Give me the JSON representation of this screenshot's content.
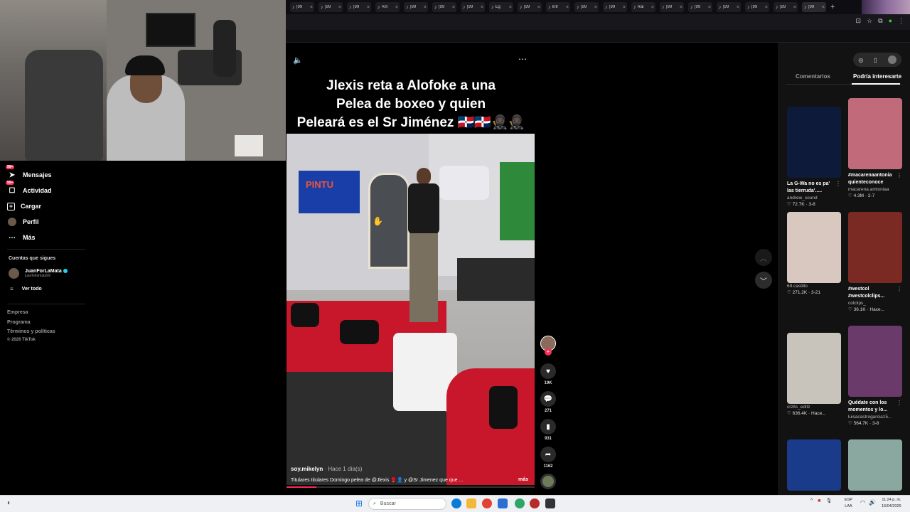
{
  "browser": {
    "tabs": [
      {
        "label": "(99"
      },
      {
        "label": "(99"
      },
      {
        "label": "(99"
      },
      {
        "label": "Am"
      },
      {
        "label": "(99"
      },
      {
        "label": "(99"
      },
      {
        "label": "(99"
      },
      {
        "label": "Eg"
      },
      {
        "label": "(99"
      },
      {
        "label": "Intr"
      },
      {
        "label": "(99"
      },
      {
        "label": "(99"
      },
      {
        "label": "Rai"
      },
      {
        "label": "(99"
      },
      {
        "label": "(99"
      },
      {
        "label": "(99"
      },
      {
        "label": "(99"
      },
      {
        "label": "(99"
      },
      {
        "label": "(99"
      }
    ],
    "new_tab": "+"
  },
  "sidebar": {
    "items": [
      {
        "label": "Mensajes",
        "icon": "paper-plane-icon",
        "badge": "99+"
      },
      {
        "label": "Actividad",
        "icon": "inbox-icon",
        "badge": "99+"
      },
      {
        "label": "Cargar",
        "icon": "plus-square-icon"
      },
      {
        "label": "Perfil",
        "icon": "avatar"
      },
      {
        "label": "Más",
        "icon": "ellipsis-icon"
      }
    ],
    "following_title": "Cuentas que sigues",
    "following": [
      {
        "name": "JuanForLaMata",
        "username": "juanforlamata99"
      }
    ],
    "see_all": "Ver todo",
    "footer": [
      "Empresa",
      "Programa",
      "Términos y políticas",
      "© 2026 TikTok"
    ]
  },
  "video": {
    "title_lines": [
      "Jlexis reta a Alofoke a una",
      "Pelea de boxeo y quien",
      "Peleará es el Sr Jiménez 🇩🇴🇩🇴🥷🏿🥷🏿"
    ],
    "sign_text": "PINTU",
    "author": "soy.mikelyn",
    "time": "· Hace 1 día(s)",
    "caption": "Titulares titulares Domingo pelea de @Jlexis 🥊👤 y @Sr Jimenez       que que ...",
    "more": "más",
    "progress_fraction": 0.12
  },
  "actions": {
    "likes": "19K",
    "comments": "271",
    "saves": "931",
    "shares": "1162"
  },
  "right_panel": {
    "tabs": [
      "Comentarios",
      "Podría interesarte"
    ],
    "cards": [
      {
        "caption": "La G-Wa no es pa' las tierruda'.....",
        "author": "andrew_sound",
        "stats": "♡ 72.7K · 3-8",
        "color": "#0d1a3a"
      },
      {
        "caption": "#macarenaantonia quienteconoce",
        "author": "macarena.amtoniaa",
        "stats": "♡ 4.3M · 2-7",
        "color": "#c06a7a"
      },
      {
        "caption": "",
        "author": "69.castillo",
        "stats": "♡ 271.2K · 3-21",
        "color": "#d8c8c0"
      },
      {
        "caption": "#westcol #westcolclips...",
        "author": "colclips_",
        "stats": "♡ 36.1K · Hace...",
        "color": "#7a2a22"
      },
      {
        "caption": "",
        "author": "crzits_editz",
        "stats": "♡ 636.4K · Hace...",
        "color": "#c8c4bc"
      },
      {
        "caption": "Quédate con los momentos y lo...",
        "author": "luisacastrogarcia15...",
        "stats": "♡ 564.7K · 3-8",
        "color": "#6a3a6a"
      },
      {
        "caption": "",
        "author": "",
        "stats": "",
        "color": "#1a3a8a"
      },
      {
        "caption": "",
        "author": "",
        "stats": "",
        "color": "#8aa8a0"
      }
    ]
  },
  "taskbar": {
    "search_placeholder": "Buscar",
    "lang": "ESP\nLAA",
    "time": "11:24 p. m.",
    "date": "16/04/2026"
  }
}
